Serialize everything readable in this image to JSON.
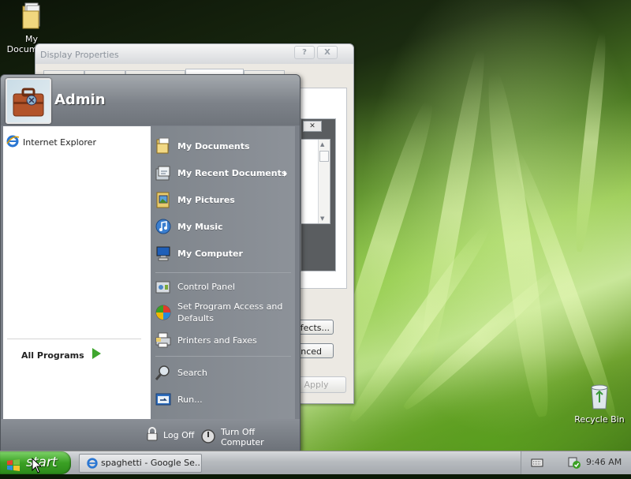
{
  "desktop": {
    "icons": [
      {
        "label": "My Documents",
        "icon": "folder-documents-icon"
      },
      {
        "label": "Recycle Bin",
        "icon": "recycle-bin-icon"
      }
    ]
  },
  "display_window": {
    "title": "Display Properties",
    "help_label": "?",
    "close_label": "X",
    "effects_button": "Effects...",
    "advanced_button": "Advanced",
    "apply_button": "Apply"
  },
  "start_menu": {
    "user_name": "Admin",
    "pinned": [
      {
        "label": "Internet Explorer",
        "icon": "internet-explorer-icon"
      }
    ],
    "all_programs_label": "All Programs",
    "places": [
      {
        "label": "My Documents",
        "icon": "my-documents-icon"
      },
      {
        "label": "My Recent Documents",
        "icon": "recent-documents-icon"
      },
      {
        "label": "My Pictures",
        "icon": "my-pictures-icon"
      },
      {
        "label": "My Music",
        "icon": "my-music-icon"
      },
      {
        "label": "My Computer",
        "icon": "my-computer-icon"
      }
    ],
    "system": [
      {
        "label": "Control Panel",
        "icon": "control-panel-icon"
      },
      {
        "label": "Set Program Access and Defaults",
        "icon": "program-access-icon"
      },
      {
        "label": "Printers and Faxes",
        "icon": "printer-icon"
      }
    ],
    "tools": [
      {
        "label": "Search",
        "icon": "search-icon"
      },
      {
        "label": "Run...",
        "icon": "run-icon"
      }
    ],
    "log_off_label": "Log Off",
    "turn_off_label": "Turn Off Computer"
  },
  "taskbar": {
    "start_label": "start",
    "task_label": "spaghetti - Google Se...",
    "clock": "9:46 AM"
  },
  "colors": {
    "start_green": "#3aa024",
    "menu_gray": "#7b8088"
  }
}
